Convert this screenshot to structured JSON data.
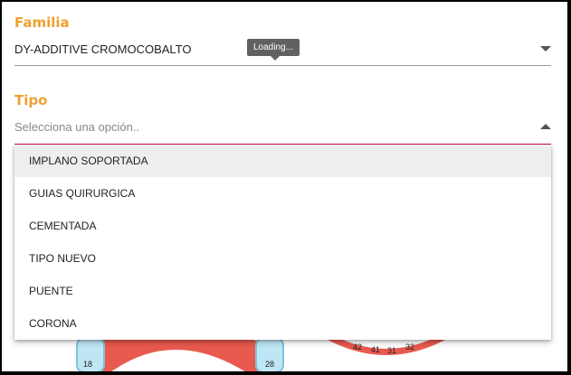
{
  "familia": {
    "label": "Familia",
    "value": "DY-ADDITIVE CROMOCOBALTO",
    "tooltip": "Loading..."
  },
  "tipo": {
    "label": "Tipo",
    "placeholder": "Selecciona una opción..",
    "options": [
      "IMPLANO SOPORTADA",
      "GUIAS QUIRURGICA",
      "CEMENTADA",
      "TIPO NUEVO",
      "PUENTE",
      "CORONA"
    ]
  },
  "teeth_chart": {
    "left_numbers": [
      "18",
      "28"
    ],
    "right_numbers": [
      "42",
      "41",
      "31",
      "32"
    ]
  },
  "colors": {
    "accent": "#f0a030",
    "focus": "#d1143f",
    "gum": "#e85a4f",
    "tooth": "#bfe6f5"
  }
}
